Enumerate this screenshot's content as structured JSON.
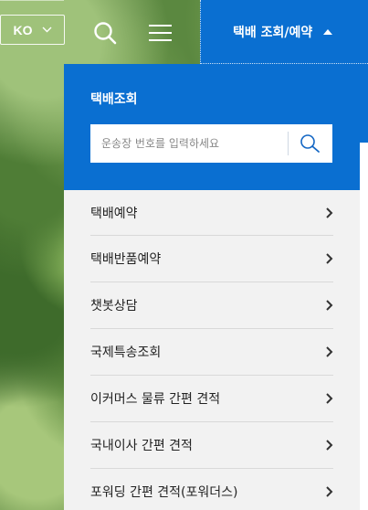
{
  "header": {
    "language": "KO",
    "track_tab_label": "택배 조회/예약"
  },
  "panel": {
    "title": "택배조회",
    "search_placeholder": "운송장 번호를 입력하세요",
    "search_value": ""
  },
  "menu": {
    "items": [
      {
        "label": "택배예약"
      },
      {
        "label": "택배반품예약"
      },
      {
        "label": "챗봇상담"
      },
      {
        "label": "국제특송조회"
      },
      {
        "label": "이커머스 물류 간편 견적"
      },
      {
        "label": "국내이사 간편 견적"
      },
      {
        "label": "포워딩 간편 견적(포워더스)"
      }
    ]
  },
  "colors": {
    "brand_blue": "#0a6fd1",
    "list_bg": "#f2f2f2"
  },
  "icons": {
    "search": "search-icon",
    "menu": "hamburger-menu-icon",
    "caret_up": "caret-up-icon",
    "chevron_right": "chevron-right-icon",
    "chevron_down": "chevron-down-icon"
  }
}
